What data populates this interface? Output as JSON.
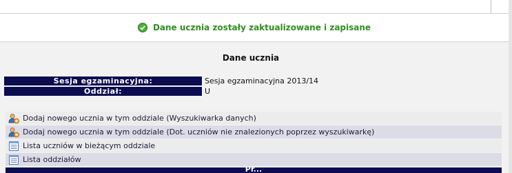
{
  "message": {
    "text": "Dane ucznia zostały zaktualizowane i zapisane",
    "icon": "check-circle-icon",
    "color": "#2f8f1f"
  },
  "page": {
    "title": "Dane ucznia"
  },
  "info": [
    {
      "label": "Sesja egzaminacyjna:",
      "value": "Sesja egzaminacyjna 2013/14"
    },
    {
      "label": "Oddział:",
      "value": "U"
    }
  ],
  "actions": [
    {
      "label": "Dodaj nowego ucznia w tym oddziale (Wyszukiwarka danych)",
      "icon": "add-user-icon"
    },
    {
      "label": "Dodaj nowego ucznia w tym oddziale (Dot. uczniów nie znalezionych poprzez wyszukiwarkę)",
      "icon": "add-user-icon"
    },
    {
      "label": "Lista uczniów w bieżącym oddziale",
      "icon": "list-icon"
    },
    {
      "label": "Lista oddziałów",
      "icon": "list-icon"
    }
  ],
  "bottom": {
    "label": "Pr..."
  },
  "colors": {
    "header_bg": "#0c0c50",
    "row_odd": "#ececec",
    "row_even": "#dcdce6"
  }
}
